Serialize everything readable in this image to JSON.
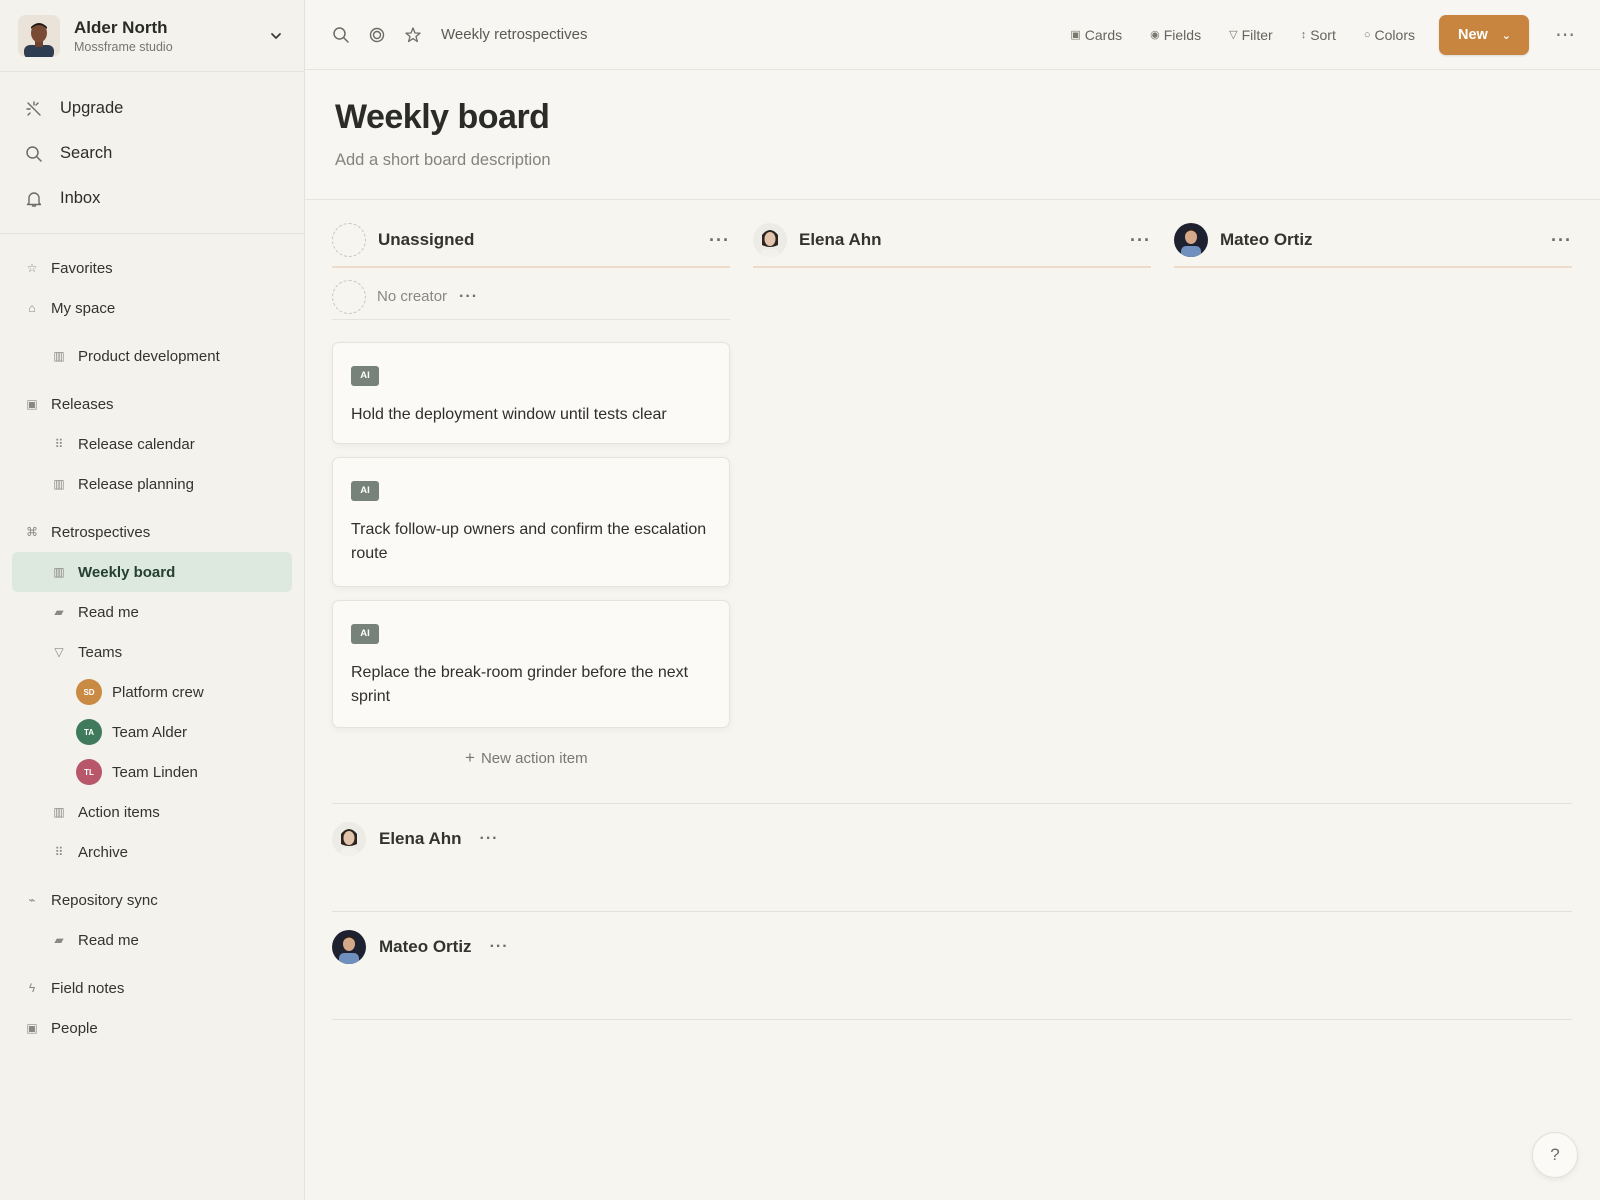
{
  "workspace": {
    "user_name": "Alder North",
    "studio": "Mossframe studio"
  },
  "quick": {
    "upgrade": "Upgrade",
    "search": "Search",
    "inbox": "Inbox"
  },
  "nav": {
    "favorites": "Favorites",
    "my_space": "My space",
    "product_development": "Product development",
    "releases": "Releases",
    "release_calendar": "Release calendar",
    "release_planning": "Release planning",
    "retrospectives": "Retrospectives",
    "weekly_board": "Weekly board",
    "read_me": "Read me",
    "teams": "Teams",
    "team_items": [
      {
        "badge": "SD",
        "label": "Platform crew",
        "color": "#c98a44"
      },
      {
        "badge": "TA",
        "label": "Team Alder",
        "color": "#3f7a5c"
      },
      {
        "badge": "TL",
        "label": "Team Linden",
        "color": "#b8566a"
      }
    ],
    "action_items": "Action items",
    "archive": "Archive",
    "repository_sync": "Repository sync",
    "read_me_2": "Read me",
    "field_notes": "Field notes",
    "people": "People"
  },
  "topbar": {
    "breadcrumb": "Weekly retrospectives",
    "cards": "Cards",
    "fields": "Fields",
    "filter": "Filter",
    "sort": "Sort",
    "colors": "Colors",
    "new": "New",
    "accent": "#c8853f"
  },
  "page": {
    "title": "Weekly board",
    "description": "Add a short board description"
  },
  "columns": [
    {
      "name": "Unassigned"
    },
    {
      "name": "Elena Ahn"
    },
    {
      "name": "Mateo Ortiz"
    }
  ],
  "group": {
    "label": "No creator"
  },
  "cards": [
    {
      "tag": "AI",
      "text": "Hold the deployment window until tests clear"
    },
    {
      "tag": "AI",
      "text": "Track follow-up owners and confirm the escalation route"
    },
    {
      "tag": "AI",
      "text": "Replace the break-room grinder before the next sprint"
    }
  ],
  "new_action_item": "New action item",
  "swimlanes": [
    {
      "name": "Elena Ahn"
    },
    {
      "name": "Mateo Ortiz"
    }
  ],
  "help": "?"
}
